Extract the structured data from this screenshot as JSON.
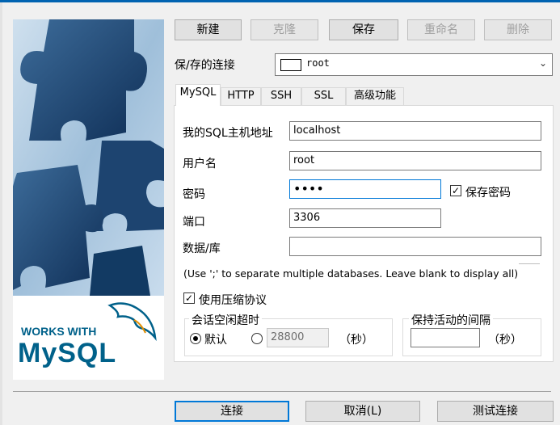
{
  "toolbar": {
    "new": "新建",
    "clone": "克隆",
    "save": "保存",
    "rename": "重命名",
    "delete": "删除"
  },
  "saved_connections": {
    "label": "保/存的连接",
    "selected": "root"
  },
  "tabs": [
    "MySQL",
    "HTTP",
    "SSH",
    "SSL",
    "高级功能"
  ],
  "form": {
    "host_label": "我的SQL主机地址",
    "host_value": "localhost",
    "user_label": "用户名",
    "user_value": "root",
    "password_label": "密码",
    "password_value": "••••",
    "save_password_label": "保存密码",
    "port_label": "端口",
    "port_value": "3306",
    "database_label": "数据/库",
    "database_value": "",
    "database_hint": "(Use ';' to separate multiple databases. Leave blank to display all)",
    "compress_label": "使用压缩协议",
    "idle_group_title": "会话空闲超时",
    "idle_default_label": "默认",
    "idle_custom_value": "28800",
    "idle_unit": "（秒）",
    "keepalive_group_title": "保持活动的间隔",
    "keepalive_value": "",
    "keepalive_unit": "（秒）"
  },
  "footer": {
    "connect": "连接",
    "cancel": "取消(L)",
    "test": "测试连接"
  },
  "logo": {
    "line1": "WORKS WITH",
    "line2": "MySQL"
  },
  "colors": {
    "accent": "#0078d7",
    "logo_blue": "#00618a",
    "logo_orange": "#e48e00"
  }
}
